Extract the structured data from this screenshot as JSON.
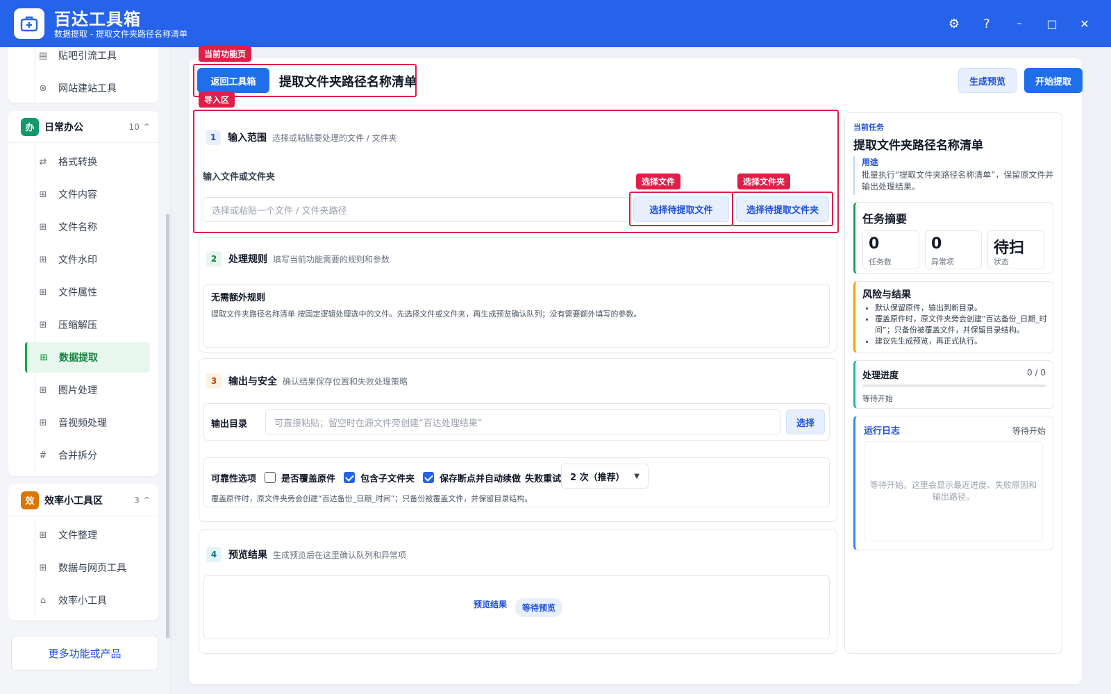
{
  "app": {
    "title": "百达工具箱",
    "subtitle": "数据提取 - 提取文件夹路径名称清单"
  },
  "window": {
    "settings": "⚙",
    "help": "?",
    "minimize": "–",
    "maximize": "□",
    "close": "✕"
  },
  "sidebar": {
    "top_items": [
      {
        "label": "贴吧引流工具",
        "icon": "document-icon"
      },
      {
        "label": "网站建站工具",
        "icon": "globe-icon"
      }
    ],
    "groups": [
      {
        "badge": "办",
        "badge_color": "#15986b",
        "title": "日常办公",
        "count": "10",
        "caret": "^",
        "items": [
          {
            "label": "格式转换",
            "icon": "swap-icon"
          },
          {
            "label": "文件内容",
            "icon": "grid-icon"
          },
          {
            "label": "文件名称",
            "icon": "grid-icon"
          },
          {
            "label": "文件水印",
            "icon": "grid-icon"
          },
          {
            "label": "文件属性",
            "icon": "grid-icon"
          },
          {
            "label": "压缩解压",
            "icon": "grid-icon"
          },
          {
            "label": "数据提取",
            "icon": "grid-icon"
          },
          {
            "label": "图片处理",
            "icon": "grid-icon"
          },
          {
            "label": "音视频处理",
            "icon": "grid-icon"
          },
          {
            "label": "合并拆分",
            "icon": "hash-icon"
          }
        ]
      },
      {
        "badge": "效",
        "badge_color": "#d97706",
        "title": "效率小工具区",
        "count": "3",
        "caret": "^",
        "items": [
          {
            "label": "文件整理",
            "icon": "grid-icon"
          },
          {
            "label": "数据与网页工具",
            "icon": "grid-icon"
          },
          {
            "label": "效率小工具",
            "icon": "toolbox-icon"
          }
        ]
      }
    ],
    "more": "更多功能或产品"
  },
  "header": {
    "tag_current": "当前功能页",
    "back": "返回工具箱",
    "title": "提取文件夹路径名称清单",
    "preview": "生成预览",
    "start": "开始提取"
  },
  "import": {
    "tag": "导入区",
    "num": "1",
    "title": "输入范围",
    "subtitle": "选择或粘贴要处理的文件 / 文件夹",
    "field_label": "输入文件或文件夹",
    "placeholder": "选择或粘贴一个文件 / 文件夹路径",
    "tag_file": "选择文件",
    "tag_folder": "选择文件夹",
    "btn_file": "选择待提取文件",
    "btn_folder": "选择待提取文件夹"
  },
  "rules": {
    "num": "2",
    "title": "处理规则",
    "subtitle": "填写当前功能需要的规则和参数",
    "box_title": "无需额外规则",
    "box_desc": "提取文件夹路径名称清单 按固定逻辑处理选中的文件。先选择文件或文件夹，再生成预览确认队列；没有需要额外填写的参数。"
  },
  "output": {
    "num": "3",
    "title": "输出与安全",
    "subtitle": "确认结果保存位置和失败处理策略",
    "dir_label": "输出目录",
    "dir_placeholder": "可直接粘贴；留空时在源文件旁创建“百达处理结果”",
    "dir_btn": "选择",
    "rel_label": "可靠性选项",
    "opt_overwrite": "是否覆盖原件",
    "opt_overwrite_checked": false,
    "opt_subfolder": "包含子文件夹",
    "opt_subfolder_checked": true,
    "opt_resume": "保存断点并自动续做",
    "opt_resume_checked": true,
    "retry_label": "失败重试",
    "retry_value": "2 次（推荐）",
    "note": "覆盖原件时，原文件夹旁会创建“百达备份_日期_时间”；只备份被覆盖文件，并保留目录结构。"
  },
  "preview": {
    "num": "4",
    "title": "预览结果",
    "subtitle": "生成预览后在这里确认队列和异常项",
    "label": "预览结果",
    "status": "等待预览"
  },
  "right": {
    "kicker": "当前任务",
    "task_title": "提取文件夹路径名称清单",
    "purpose_label": "用途",
    "purpose_text": "批量执行“提取文件夹路径名称清单”，保留原文件并输出处理结果。",
    "summary_title": "任务摘要",
    "stats": [
      {
        "value": "0",
        "label": "任务数"
      },
      {
        "value": "0",
        "label": "异常项"
      },
      {
        "value": "待扫",
        "label": "状态"
      }
    ],
    "risk_title": "风险与结果",
    "risks": [
      "默认保留原件，输出到新目录。",
      "覆盖原件时，原文件夹旁会创建“百达备份_日期_时间”；只备份被覆盖文件，并保留目录结构。",
      "建议先生成预览，再正式执行。"
    ],
    "progress_title": "处理进度",
    "progress_count": "0 / 0",
    "progress_fraction": 0,
    "progress_status": "等待开始",
    "log_title": "运行日志",
    "log_status": "等待开始",
    "log_placeholder": "等待开始。这里会显示最近进度、失败原因和输出路径。"
  }
}
